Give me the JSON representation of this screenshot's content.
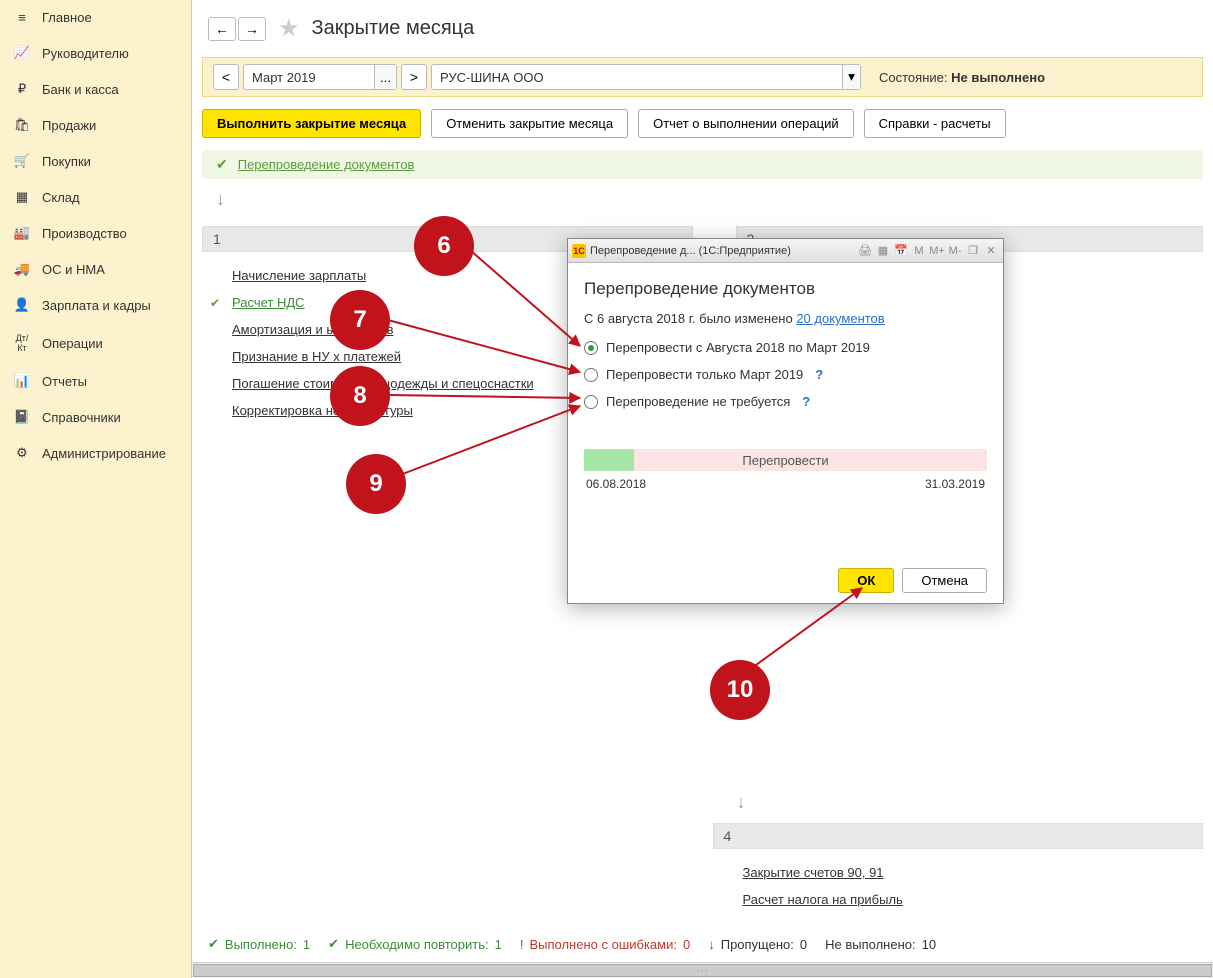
{
  "sidebar": {
    "items": [
      {
        "icon": "≡",
        "label": "Главное"
      },
      {
        "icon": "📈",
        "label": "Руководителю"
      },
      {
        "icon": "₽",
        "label": "Банк и касса"
      },
      {
        "icon": "🛍",
        "label": "Продажи"
      },
      {
        "icon": "🛒",
        "label": "Покупки"
      },
      {
        "icon": "▦",
        "label": "Склад"
      },
      {
        "icon": "🏭",
        "label": "Производство"
      },
      {
        "icon": "🚚",
        "label": "ОС и НМА"
      },
      {
        "icon": "👤",
        "label": "Зарплата и кадры"
      },
      {
        "icon": "Дт/Кт",
        "label": "Операции"
      },
      {
        "icon": "📊",
        "label": "Отчеты"
      },
      {
        "icon": "📓",
        "label": "Справочники"
      },
      {
        "icon": "⚙",
        "label": "Администрирование"
      }
    ]
  },
  "header": {
    "title": "Закрытие месяца"
  },
  "filter": {
    "period": "Март 2019",
    "org": "РУС-ШИНА ООО",
    "status_label": "Состояние:",
    "status_value": "Не выполнено"
  },
  "actions": {
    "run": "Выполнить закрытие месяца",
    "cancel": "Отменить закрытие месяца",
    "report": "Отчет о выполнении операций",
    "refs": "Справки - расчеты"
  },
  "top_link": "Перепроведение документов",
  "col1_num": "1",
  "col2_num": "2",
  "col4_num": "4",
  "tasks1": [
    {
      "label": "Начисление зарплаты",
      "icon": ""
    },
    {
      "label": "Расчет НДС",
      "icon": "✔",
      "green": true
    },
    {
      "label": "Амортизация и                    ых средств",
      "icon": ""
    },
    {
      "label": "Признание в НУ                   х платежей",
      "icon": ""
    },
    {
      "label": "Погашение стоимост   спецодежды и спецоснастки",
      "icon": ""
    },
    {
      "label": "Корректировка                    номенклатуры",
      "icon": ""
    }
  ],
  "tasks4": [
    {
      "label": "Закрытие счетов 90, 91"
    },
    {
      "label": "Расчет налога на прибыль"
    }
  ],
  "popup": {
    "wintitle": "Перепроведение д...  (1С:Предприятие)",
    "heading": "Перепроведение документов",
    "info_pre": "С 6 августа 2018 г. было изменено ",
    "info_link": "20 документов",
    "r1": "Перепровести с Августа 2018 по Март 2019",
    "r2": "Перепровести только Март 2019",
    "r3": "Перепроведение не требуется",
    "progress_label": "Перепровести",
    "date_from": "06.08.2018",
    "date_to": "31.03.2019",
    "ok": "ОК",
    "cancel": "Отмена"
  },
  "callouts": {
    "c6": "6",
    "c7": "7",
    "c8": "8",
    "c9": "9",
    "c10": "10"
  },
  "footer": {
    "done_l": "Выполнено:",
    "done_v": "1",
    "repeat_l": "Необходимо повторить:",
    "repeat_v": "1",
    "err_l": "Выполнено с ошибками:",
    "err_v": "0",
    "skip_l": "Пропущено:",
    "skip_v": "0",
    "not_l": "Не выполнено:",
    "not_v": "10"
  }
}
